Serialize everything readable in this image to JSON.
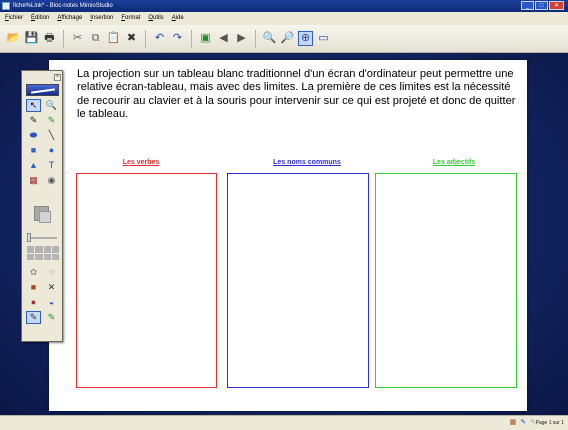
{
  "window": {
    "title": "fiche%Link* - Bloc-notes MimioStudio",
    "minimize": "_",
    "maximize": "□",
    "close": "✕"
  },
  "menu": [
    "Fichier",
    "Édition",
    "Affichage",
    "Insertion",
    "Format",
    "Outils",
    "Aide"
  ],
  "toolbar": [
    {
      "name": "import-icon",
      "glyph": "📂",
      "color": "#2a8a2a"
    },
    {
      "name": "save-icon",
      "glyph": "💾",
      "color": "#d08020"
    },
    {
      "name": "print-icon",
      "glyph": "🖶",
      "color": "#333"
    },
    {
      "sep": true
    },
    {
      "name": "cut-icon",
      "glyph": "✂",
      "color": "#666"
    },
    {
      "name": "copy-icon",
      "glyph": "⧉",
      "color": "#666"
    },
    {
      "name": "paste-icon",
      "glyph": "📋",
      "color": "#666"
    },
    {
      "name": "delete-icon",
      "glyph": "✖",
      "color": "#333"
    },
    {
      "sep": true
    },
    {
      "name": "undo-icon",
      "glyph": "↶",
      "color": "#2050b0"
    },
    {
      "name": "redo-icon",
      "glyph": "↷",
      "color": "#2050b0"
    },
    {
      "sep": true
    },
    {
      "name": "new-page-icon",
      "glyph": "▣",
      "color": "#2a8a2a"
    },
    {
      "name": "previous-page-icon",
      "glyph": "◀",
      "color": "#555"
    },
    {
      "name": "next-page-icon",
      "glyph": "▶",
      "color": "#555"
    },
    {
      "sep": true
    },
    {
      "name": "zoom-in-icon",
      "glyph": "🔍",
      "color": "#2050b0"
    },
    {
      "name": "zoom-out-icon",
      "glyph": "🔎",
      "color": "#2050b0"
    },
    {
      "name": "zoom-fit-icon",
      "glyph": "⊕",
      "color": "#2050b0",
      "active": true
    },
    {
      "name": "full-screen-icon",
      "glyph": "▭",
      "color": "#2050b0"
    }
  ],
  "page": {
    "paragraph": "La projection sur un tableau blanc traditionnel d'un écran d'ordinateur peut permettre une relative écran-tableau, mais avec des limites. La première de ces limites est la nécessité de recourir au clavier et à la souris pour intervenir sur ce qui est projeté et donc de quitter le tableau.",
    "columns": [
      {
        "title": "Les verbes",
        "color": "#e03030"
      },
      {
        "title": "Les noms communs",
        "color": "#3030d0"
      },
      {
        "title": "Les adjectifs",
        "color": "#33d033"
      }
    ]
  },
  "palette": {
    "close": "×",
    "tools": [
      {
        "name": "select-arrow-icon",
        "glyph": "↖",
        "color": "#000",
        "sel": true
      },
      {
        "name": "zoom-tool-icon",
        "glyph": "🔍",
        "color": "#2050b0"
      },
      {
        "name": "pen-icon",
        "glyph": "✎",
        "color": "#222"
      },
      {
        "name": "highlighter-icon",
        "glyph": "✎",
        "color": "#2a9a2a"
      },
      {
        "name": "eraser-icon",
        "glyph": "⬬",
        "color": "#3050c0"
      },
      {
        "name": "line-icon",
        "glyph": "╲",
        "color": "#222"
      },
      {
        "name": "rectangle-icon",
        "glyph": "■",
        "color": "#3060d0"
      },
      {
        "name": "ellipse-icon",
        "glyph": "●",
        "color": "#3060d0"
      },
      {
        "name": "triangle-icon",
        "glyph": "▲",
        "color": "#3060d0"
      },
      {
        "name": "text-icon",
        "glyph": "T",
        "color": "#2050b0"
      },
      {
        "name": "image-icon",
        "glyph": "▦",
        "color": "#a03030"
      },
      {
        "name": "screen-capture-icon",
        "glyph": "◉",
        "color": "#555"
      }
    ],
    "tools_bottom": [
      {
        "name": "fill-icon",
        "glyph": "✿",
        "color": "#999"
      },
      {
        "name": "hand-icon",
        "glyph": "☜",
        "color": "#999"
      },
      {
        "name": "stamp-icon",
        "glyph": "■",
        "color": "#a05020"
      },
      {
        "name": "delete-tool-icon",
        "glyph": "✕",
        "color": "#333"
      },
      {
        "name": "reveal-icon",
        "glyph": "●",
        "color": "#a03030"
      },
      {
        "name": "spotlight-icon",
        "glyph": "◒",
        "color": "#3050b0"
      },
      {
        "name": "recognition-icon",
        "glyph": "✎",
        "color": "#333",
        "sel": true
      },
      {
        "name": "handwriting-icon",
        "glyph": "✎",
        "color": "#2a8a2a"
      }
    ]
  },
  "status": {
    "page_info": "Page 1 sur 1",
    "icons": [
      {
        "name": "status-grid-icon",
        "glyph": "▦",
        "color": "#a05020"
      },
      {
        "name": "status-pen-icon",
        "glyph": "✎",
        "color": "#2050b0"
      },
      {
        "name": "status-highlight-icon",
        "glyph": "✎",
        "color": "#a0a0a0"
      }
    ]
  }
}
